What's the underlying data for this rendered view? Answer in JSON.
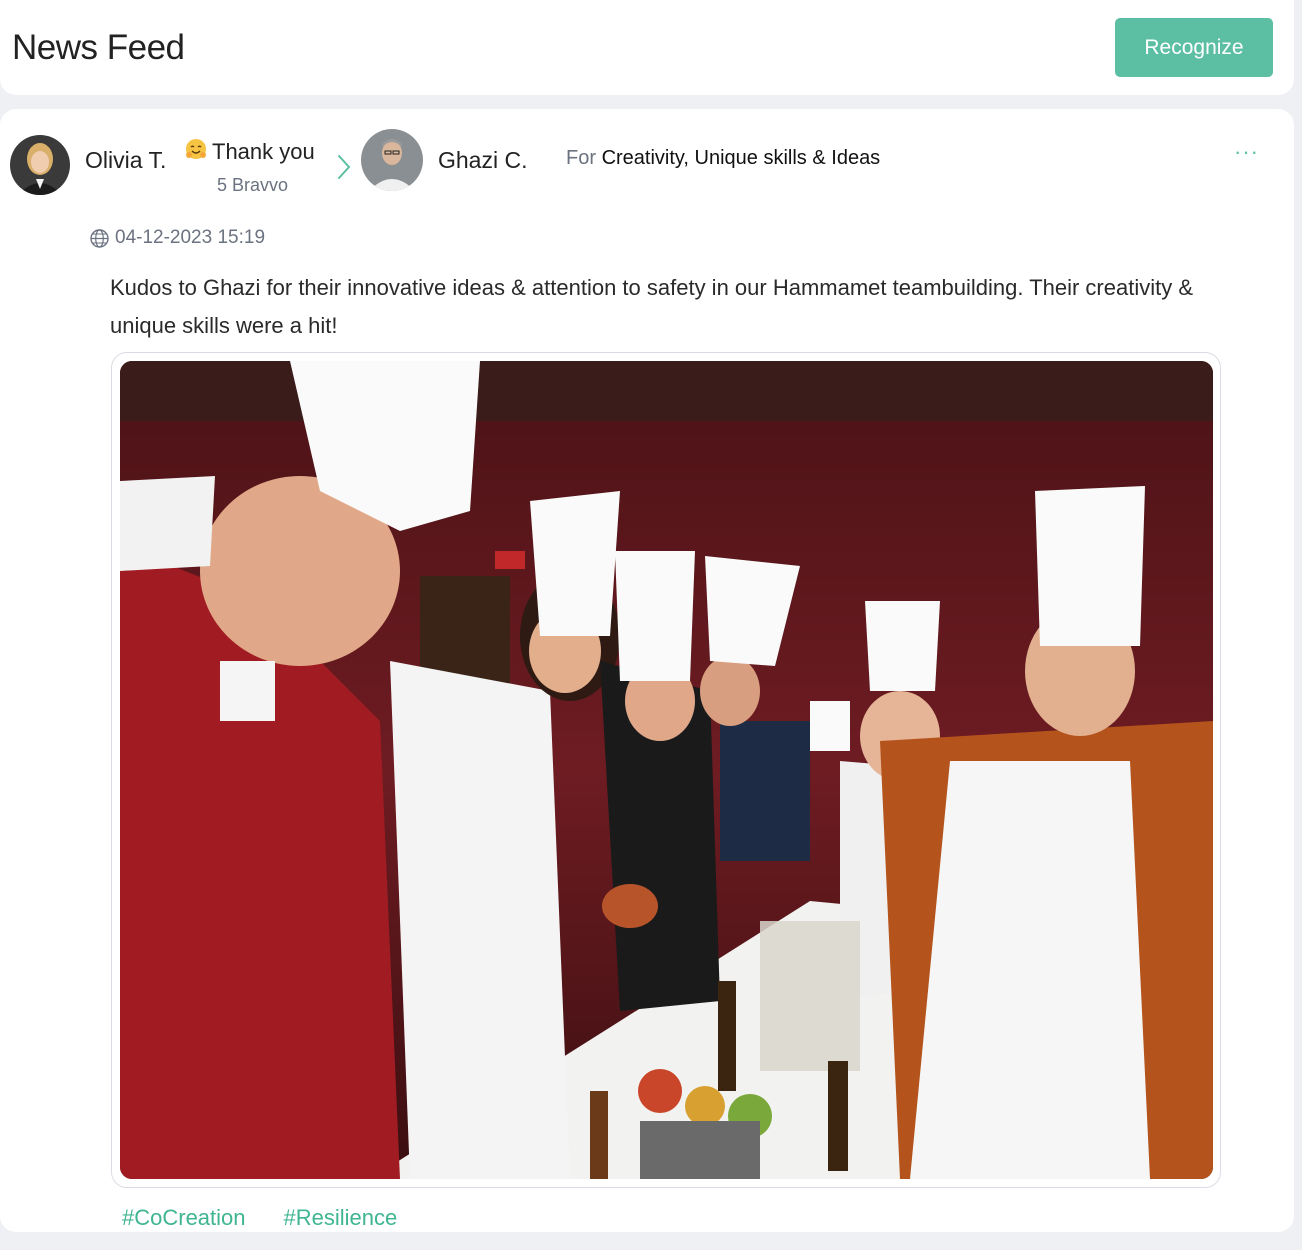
{
  "header": {
    "title": "News Feed",
    "recognize_label": "Recognize"
  },
  "post": {
    "sender": {
      "name": "Olivia T."
    },
    "badge": {
      "emoji": "hugging-face-icon",
      "label": "Thank you",
      "points": "5 Bravvo"
    },
    "recipient": {
      "name": "Ghazi C."
    },
    "for_prefix": "For",
    "values": "Creativity, Unique skills & Ideas",
    "more_label": "···",
    "timestamp": "04-12-2023 15:19",
    "message": "Kudos to Ghazi for their innovative ideas & attention to safety in our Hammamet teambuilding. Their creativity & unique skills were a hit!",
    "hashtags": [
      "#CoCreation",
      "#Resilience"
    ]
  },
  "colors": {
    "accent": "#5cbfa3",
    "hashtag": "#3fb592",
    "background": "#eef0f4"
  }
}
